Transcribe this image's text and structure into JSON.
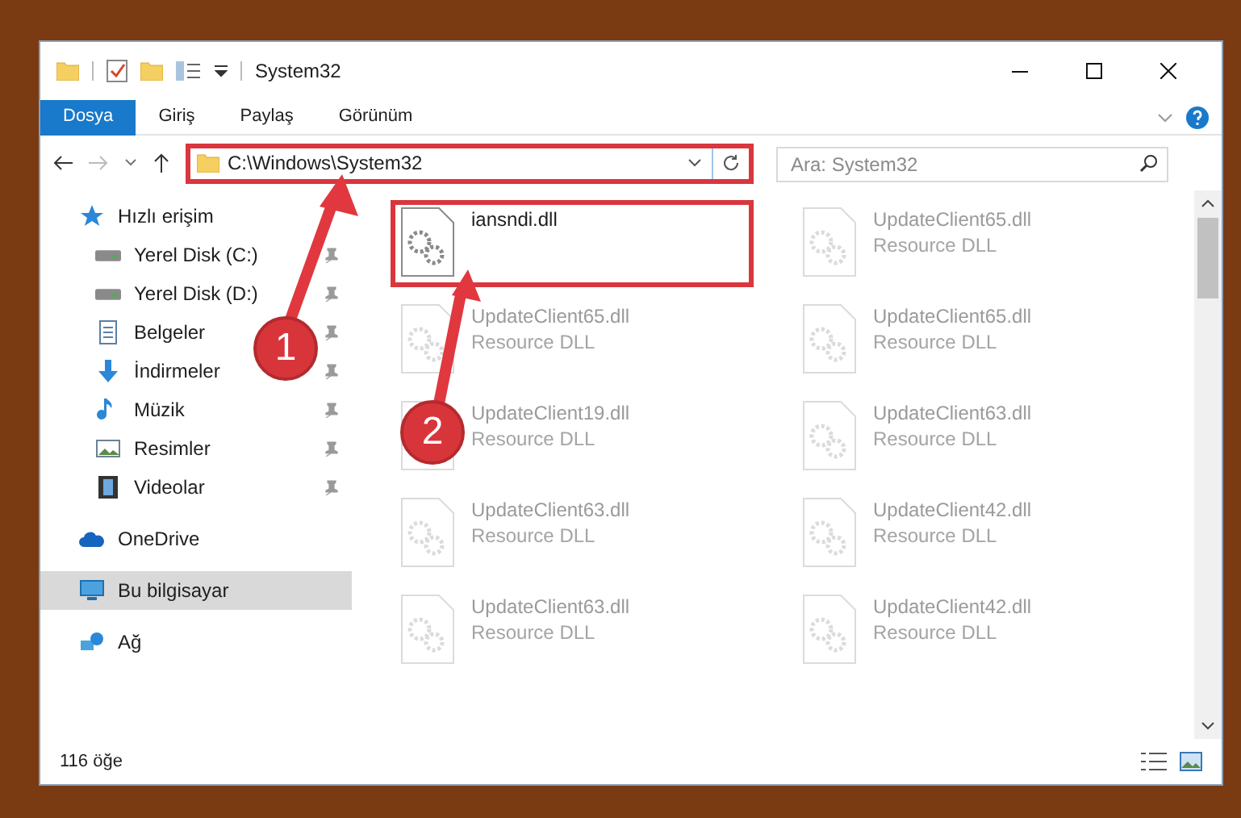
{
  "window": {
    "title": "System32"
  },
  "ribbon": {
    "tabs": [
      {
        "label": "Dosya",
        "selected": true
      },
      {
        "label": "Giriş",
        "selected": false
      },
      {
        "label": "Paylaş",
        "selected": false
      },
      {
        "label": "Görünüm",
        "selected": false
      }
    ]
  },
  "address_bar": {
    "path": "C:\\Windows\\System32",
    "highlighted": true
  },
  "search": {
    "placeholder": "Ara: System32"
  },
  "nav": {
    "items": [
      {
        "label": "Hızlı erişim",
        "kind": "star",
        "selected": false,
        "children": [
          {
            "label": "Yerel Disk (C:)",
            "kind": "drive",
            "pinned": true
          },
          {
            "label": "Yerel Disk (D:)",
            "kind": "drive",
            "pinned": true
          },
          {
            "label": "Belgeler",
            "kind": "document",
            "pinned": true
          },
          {
            "label": "İndirmeler",
            "kind": "download",
            "pinned": true
          },
          {
            "label": "Müzik",
            "kind": "music",
            "pinned": true
          },
          {
            "label": "Resimler",
            "kind": "picture",
            "pinned": true
          },
          {
            "label": "Videolar",
            "kind": "video",
            "pinned": true
          }
        ]
      },
      {
        "label": "OneDrive",
        "kind": "cloud",
        "selected": false
      },
      {
        "label": "Bu bilgisayar",
        "kind": "computer",
        "selected": true
      },
      {
        "label": "Ağ",
        "kind": "network",
        "selected": false
      }
    ]
  },
  "files": [
    {
      "name": "iansndi.dll",
      "highlighted": true
    },
    {
      "name": "UpdateClient65.dll",
      "type": "Resource DLL",
      "highlighted": false
    },
    {
      "name": "UpdateClient65.dll",
      "type": "Resource DLL",
      "highlighted": false
    },
    {
      "name": "UpdateClient65.dll",
      "type": "Resource DLL",
      "highlighted": false
    },
    {
      "name": "UpdateClient19.dll",
      "type": "Resource DLL",
      "highlighted": false
    },
    {
      "name": "UpdateClient63.dll",
      "type": "Resource DLL",
      "highlighted": false
    },
    {
      "name": "UpdateClient63.dll",
      "type": "Resource DLL",
      "highlighted": false
    },
    {
      "name": "UpdateClient42.dll",
      "type": "Resource DLL",
      "highlighted": false
    },
    {
      "name": "UpdateClient63.dll",
      "type": "Resource DLL",
      "highlighted": false
    },
    {
      "name": "UpdateClient42.dll",
      "type": "Resource DLL",
      "highlighted": false
    }
  ],
  "annotations": [
    {
      "label": "1"
    },
    {
      "label": "2"
    }
  ],
  "status_bar": {
    "count": "116 öğe"
  }
}
